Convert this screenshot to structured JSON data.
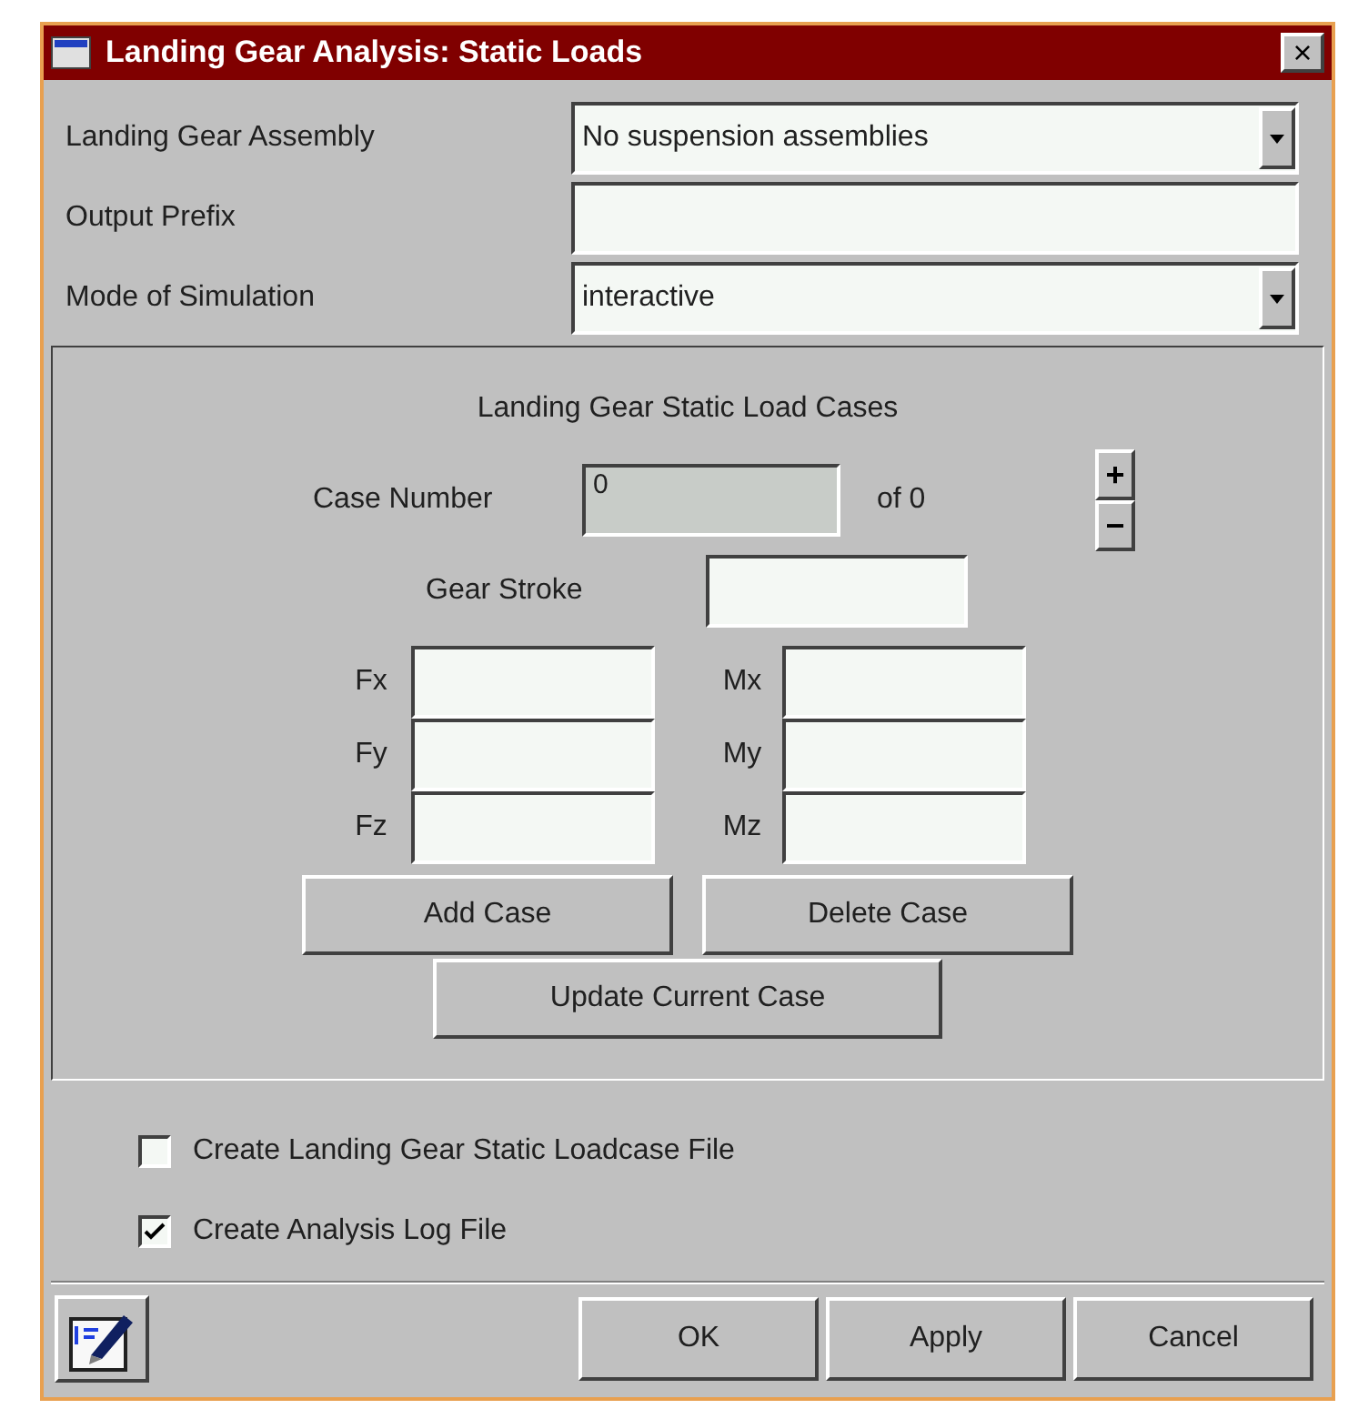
{
  "window": {
    "title": "Landing Gear Analysis: Static Loads",
    "close": "×"
  },
  "form_rows": [
    {
      "kind": "dropdown",
      "label": "Landing Gear Assembly",
      "value": "No suspension assemblies"
    },
    {
      "kind": "text",
      "label": "Output Prefix"
    },
    {
      "kind": "dropdown",
      "label": "Mode of Simulation",
      "value": "interactive"
    }
  ],
  "load_cases": {
    "title": "Landing Gear Static Load Cases",
    "case_number_label": "Case Number",
    "case_number": "0",
    "case_number_disabled": true,
    "of_total": "of 0",
    "increment": "+",
    "decrement": "−",
    "gear_stroke_label": "Gear Stroke",
    "forces": [
      "Fx",
      "Fy",
      "Fz"
    ],
    "moments": [
      "Mx",
      "My",
      "Mz"
    ],
    "add_button": "Add Case",
    "delete_button": "Delete Case",
    "update_button": "Update Current Case"
  },
  "checkboxes": [
    {
      "label": "Create Landing Gear Static Loadcase File",
      "checked": false
    },
    {
      "label": "Create Analysis Log File",
      "checked": true
    }
  ],
  "buttons": [
    "OK",
    "Apply",
    "Cancel"
  ]
}
